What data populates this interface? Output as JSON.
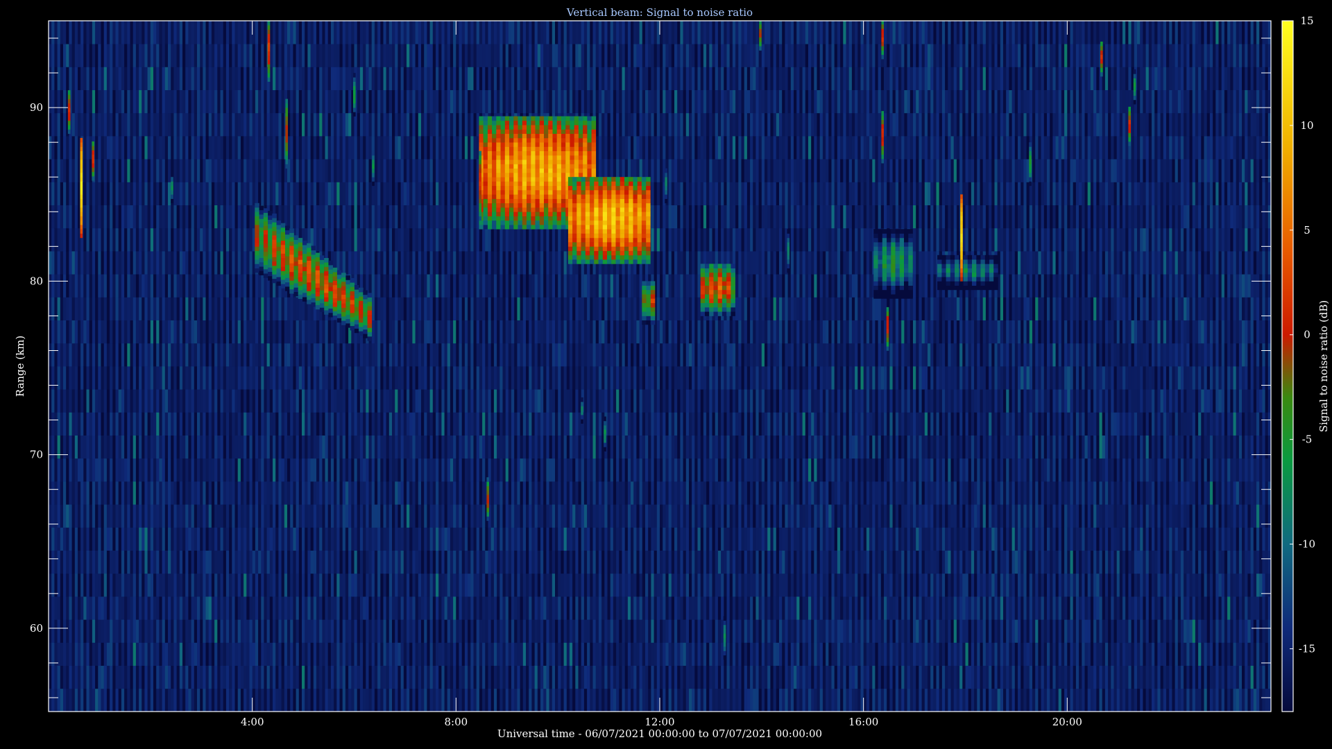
{
  "chart_data": {
    "type": "heatmap",
    "title": "Vertical beam: Signal to noise ratio",
    "xlabel": "Universal time - 06/07/2021 00:00:00 to 07/07/2021 00:00:00",
    "ylabel": "Range (km)",
    "colorbar_label": "Signal to noise ratio (dB)",
    "x_unit": "hours UT",
    "xlim": [
      0,
      24
    ],
    "ylim": [
      55.2,
      95.0
    ],
    "clim": [
      -18,
      15
    ],
    "x_ticks": [
      {
        "value": 4,
        "label": "4:00"
      },
      {
        "value": 8,
        "label": "8:00"
      },
      {
        "value": 12,
        "label": "12:00"
      },
      {
        "value": 16,
        "label": "16:00"
      },
      {
        "value": 20,
        "label": "20:00"
      }
    ],
    "y_ticks": [
      {
        "value": 60,
        "label": "60"
      },
      {
        "value": 70,
        "label": "70"
      },
      {
        "value": 80,
        "label": "80"
      },
      {
        "value": 90,
        "label": "90"
      }
    ],
    "colorbar_ticks": [
      {
        "value": 15,
        "label": "15"
      },
      {
        "value": 10,
        "label": "10"
      },
      {
        "value": 5,
        "label": "5"
      },
      {
        "value": 0,
        "label": "0"
      },
      {
        "value": -5,
        "label": "-5"
      },
      {
        "value": -10,
        "label": "-10"
      },
      {
        "value": -15,
        "label": "-15"
      }
    ],
    "colormap": [
      {
        "value": -18,
        "color": "#050a3c"
      },
      {
        "value": -14,
        "color": "#0f2a7a"
      },
      {
        "value": -10,
        "color": "#106a80"
      },
      {
        "value": -6,
        "color": "#0a9a40"
      },
      {
        "value": -3,
        "color": "#3a8a10"
      },
      {
        "value": 0,
        "color": "#cc1a00"
      },
      {
        "value": 4,
        "color": "#e85a00"
      },
      {
        "value": 9,
        "color": "#f0b000"
      },
      {
        "value": 15,
        "color": "#ffff20"
      }
    ],
    "background_level_db": -15,
    "echo_regions": [
      {
        "t_start": 4.05,
        "t_end": 6.3,
        "range_top_start": 84.5,
        "range_bottom_start": 80.5,
        "range_top_end": 79.0,
        "range_bottom_end": 76.5,
        "peak_db": 4
      },
      {
        "t_start": 8.45,
        "t_end": 10.7,
        "range_top": 89.5,
        "range_bottom": 83.0,
        "peak_db": 11
      },
      {
        "t_start": 10.2,
        "t_end": 11.8,
        "range_top": 86.0,
        "range_bottom": 81.0,
        "peak_db": 12
      },
      {
        "t_start": 11.65,
        "t_end": 11.9,
        "range_top": 80.0,
        "range_bottom": 77.5,
        "peak_db": 2
      },
      {
        "t_start": 16.2,
        "t_end": 16.9,
        "range_top": 83.0,
        "range_bottom": 79.0,
        "peak_db": -4
      },
      {
        "t_start": 17.45,
        "t_end": 18.6,
        "range_top": 81.5,
        "range_bottom": 79.5,
        "peak_db": -6
      },
      {
        "t_start": 12.8,
        "t_end": 13.4,
        "range_top": 81.0,
        "range_bottom": 78.0,
        "peak_db": 5
      }
    ],
    "isolated_echoes": [
      {
        "t": 0.62,
        "range_top": 88.2,
        "range_bottom": 82.5,
        "peak_db": 13
      },
      {
        "t": 0.38,
        "range_top": 91.0,
        "range_bottom": 88.5,
        "peak_db": 1
      },
      {
        "t": 0.85,
        "range_top": 88.0,
        "range_bottom": 85.8,
        "peak_db": 2
      },
      {
        "t": 4.3,
        "range_top": 95.0,
        "range_bottom": 91.5,
        "peak_db": 2
      },
      {
        "t": 4.65,
        "range_top": 90.5,
        "range_bottom": 86.5,
        "peak_db": 0
      },
      {
        "t": 5.98,
        "range_top": 91.8,
        "range_bottom": 89.5,
        "peak_db": -5
      },
      {
        "t": 8.6,
        "range_top": 68.5,
        "range_bottom": 66.2,
        "peak_db": 0
      },
      {
        "t": 8.45,
        "range_top": 87.5,
        "range_bottom": 83.5,
        "peak_db": 1
      },
      {
        "t": 13.95,
        "range_top": 95.0,
        "range_bottom": 93.3,
        "peak_db": 0
      },
      {
        "t": 16.35,
        "range_top": 95.0,
        "range_bottom": 92.8,
        "peak_db": 1
      },
      {
        "t": 16.35,
        "range_top": 89.8,
        "range_bottom": 86.8,
        "peak_db": 1
      },
      {
        "t": 16.45,
        "range_top": 78.5,
        "range_bottom": 76.0,
        "peak_db": 1
      },
      {
        "t": 17.9,
        "range_top": 85.0,
        "range_bottom": 80.0,
        "peak_db": 12
      },
      {
        "t": 20.65,
        "range_top": 93.8,
        "range_bottom": 91.8,
        "peak_db": 1
      },
      {
        "t": 21.2,
        "range_top": 90.0,
        "range_bottom": 87.8,
        "peak_db": 1
      },
      {
        "t": 21.3,
        "range_top": 92.0,
        "range_bottom": 90.2,
        "peak_db": -6
      },
      {
        "t": 19.25,
        "range_top": 88.0,
        "range_bottom": 85.5,
        "peak_db": -5
      },
      {
        "t": 13.25,
        "range_top": 60.5,
        "range_bottom": 58.2,
        "peak_db": -7
      },
      {
        "t": 10.9,
        "range_top": 72.0,
        "range_bottom": 70.2,
        "peak_db": -7
      },
      {
        "t": 2.4,
        "range_top": 86.0,
        "range_bottom": 84.5,
        "peak_db": -7
      },
      {
        "t": 6.35,
        "range_top": 87.5,
        "range_bottom": 85.5,
        "peak_db": -7
      },
      {
        "t": 14.5,
        "range_top": 82.8,
        "range_bottom": 80.5,
        "peak_db": -8
      },
      {
        "t": 12.1,
        "range_top": 86.5,
        "range_bottom": 84.5,
        "peak_db": -8
      },
      {
        "t": 10.45,
        "range_top": 73.2,
        "range_bottom": 71.8,
        "peak_db": -9
      }
    ]
  }
}
